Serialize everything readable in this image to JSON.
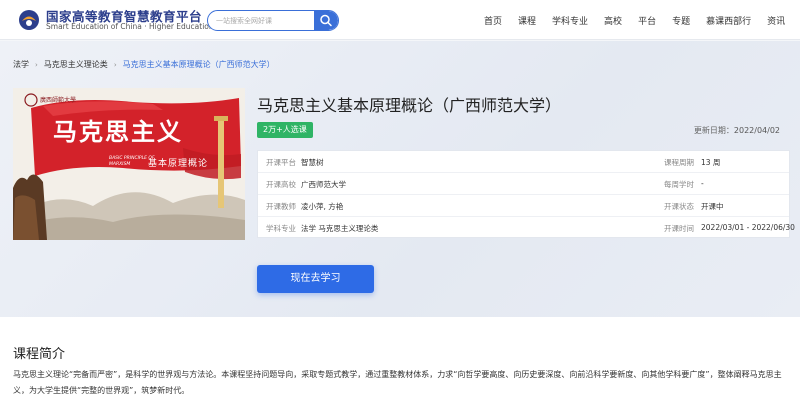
{
  "header": {
    "logo_cn": "国家高等教育智慧教育平台",
    "logo_en": "Smart Education of China · Higher Education",
    "search_placeholder": "一站搜索全网好课",
    "nav": [
      "首页",
      "课程",
      "学科专业",
      "高校",
      "平台",
      "专题",
      "慕课西部行",
      "资讯"
    ]
  },
  "breadcrumb": [
    "法学",
    "马克思主义理论类",
    "马克思主义基本原理概论（广西师范大学）"
  ],
  "course": {
    "image_title_cn": "马克思主义",
    "image_subtitle_cn": "基本原理概论",
    "image_subtitle_en": "BASIC PRINCIPLE OF MARXISM",
    "image_school": "廣西師範大學",
    "title": "马克思主义基本原理概论（广西师范大学）",
    "enroll_badge": "2万+人选课",
    "update_label": "更新日期：",
    "update_value": "2022/04/02",
    "info": {
      "platform_label": "开课平台",
      "platform_value": "智慧树",
      "school_label": "开课高校",
      "school_value": "广西师范大学",
      "teacher_label": "开课教师",
      "teacher_value": "凌小萍, 方艳",
      "subject_label": "学科专业",
      "subject_value": "法学 马克思主义理论类",
      "period_label": "课程周期",
      "period_value": "13 周",
      "weekly_label": "每周学时",
      "weekly_value": "-",
      "status_label": "开课状态",
      "status_value": "开课中",
      "time_label": "开课时间",
      "time_value": "2022/03/01 - 2022/06/30"
    },
    "study_button": "现在去学习"
  },
  "intro": {
    "title": "课程简介",
    "text": "马克思主义理论“完备而严密”，是科学的世界观与方法论。本课程坚持问题导向，采取专题式教学，通过重整教材体系，力求“向哲学要高度、向历史要深度、向前沿科学要新度、向其他学科要广度”，整体阐释马克思主义，为大学生提供“完整的世界观”，筑梦新时代。"
  },
  "colors": {
    "accent": "#2e6be6",
    "badge": "#2fb465",
    "logo": "#2c3e8c",
    "banner_red": "#d3222a"
  }
}
